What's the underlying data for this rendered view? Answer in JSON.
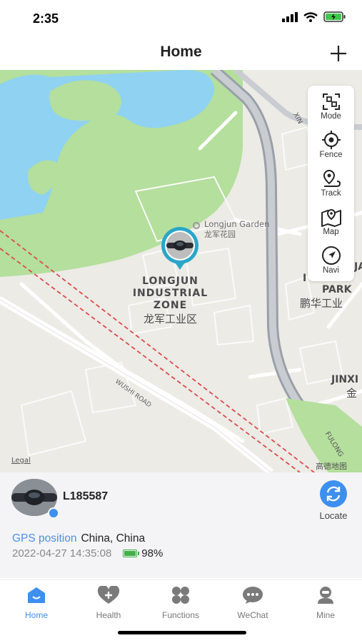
{
  "status_bar": {
    "time": "2:35"
  },
  "header": {
    "title": "Home"
  },
  "map": {
    "labels": {
      "garden_en": "Longjun Garden",
      "garden_cn": "龙军花园",
      "zone_line1": "LONGJUN",
      "zone_line2": "INDUSTRIAL",
      "zone_line3": "ZONE",
      "zone_cn": "龙军工业区",
      "park_en": "PARK",
      "park_cn": "鹏华工业",
      "jinxi_en": "JINXI",
      "jinxi_cn": "金",
      "road_wushi": "WUSHI ROAD",
      "road_fulong": "FULONG",
      "road_xin": "XIN",
      "side_j": "JA",
      "side_i": "I",
      "legal": "Legal",
      "attribution": "高德地图"
    },
    "tools": [
      {
        "label": "Mode",
        "icon": "mode-icon"
      },
      {
        "label": "Fence",
        "icon": "fence-icon"
      },
      {
        "label": "Track",
        "icon": "track-icon"
      },
      {
        "label": "Map",
        "icon": "map-icon"
      },
      {
        "label": "Navi",
        "icon": "navi-icon"
      }
    ]
  },
  "device": {
    "name": "L185587",
    "locate_label": "Locate",
    "gps_label": "GPS position",
    "gps_value": "China, China",
    "timestamp": "2022-04-27 14:35:08",
    "battery": "98%",
    "battery_level": 0.98
  },
  "tabs": [
    {
      "label": "Home",
      "icon": "home-icon",
      "active": true
    },
    {
      "label": "Health",
      "icon": "health-icon",
      "active": false
    },
    {
      "label": "Functions",
      "icon": "functions-icon",
      "active": false
    },
    {
      "label": "WeChat",
      "icon": "wechat-icon",
      "active": false
    },
    {
      "label": "Mine",
      "icon": "mine-icon",
      "active": false
    }
  ],
  "colors": {
    "accent": "#3d8ff0",
    "battery": "#43b047",
    "water": "#8fd2f2",
    "park": "#b4df9c"
  }
}
